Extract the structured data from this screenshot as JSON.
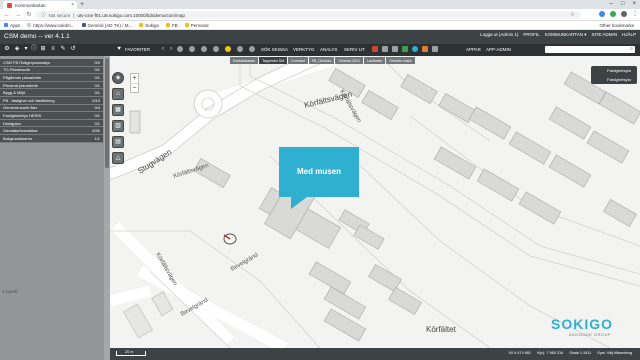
{
  "browser": {
    "tab_title": "Kommunkartan",
    "not_secure": "Not secure",
    "url": "utv-csm-f01.utv.sokigo.com:10000/bdsdemo/csm/map",
    "bookmarks": [
      "Apps",
      "https://www.sokdm...",
      "General (AD TK) / M...",
      "Sokigo",
      "FB",
      "Personal"
    ],
    "other_bookmarks": "Other bookmarks"
  },
  "app": {
    "title": "CSM demo -- ver 4.1.1",
    "user_nav": [
      "Logga ut (Admin 1)",
      "PROFIL",
      "KOMMUNKARTAN ▾",
      "SITE ADMIN",
      "HJÄLP"
    ],
    "toolbar_labels": {
      "favorites": "FAVORITER",
      "sok_skissa": "SÖK SKISSA",
      "verktyg": "VERKTYG",
      "analys": "ANALYS",
      "skriv_ut": "SKRIV UT",
      "appar": "APPAR",
      "app_admin": "APP-ADMIN"
    }
  },
  "sidebar": {
    "layers": [
      {
        "name": "CSM FB Rotigerpasanalys",
        "count": "0/0"
      },
      {
        "name": "TO-Planeracde",
        "count": "0/1"
      },
      {
        "name": "Pågående planarbete",
        "count": "0/1"
      },
      {
        "name": "Planerat planarbete",
        "count": "0/1"
      },
      {
        "name": "Bygg & Miljö",
        "count": "0/1"
      },
      {
        "name": "FB - fastighet och fastifulning",
        "count": "0/10"
      },
      {
        "name": "Gemenensamt åter",
        "count": "0/4"
      },
      {
        "name": "Fastighetsfrys HERIS",
        "count": "0/1"
      },
      {
        "name": "Detaljplan",
        "count": "0/1"
      },
      {
        "name": "Geodata/översiktsa",
        "count": "0/30"
      },
      {
        "name": "Bakgrundskartor",
        "count": "1/1"
      }
    ],
    "map_label": "s kapell"
  },
  "map": {
    "tabs": [
      "Kontaktkartan",
      "Tapperdsl DM",
      "Kontrast",
      "FB_Ortofoto",
      "Ortofoto 2021",
      "Lantkarte",
      "Ortofoto makk"
    ],
    "active_tab": 1,
    "background_items": [
      "Fastighetsyta",
      "Fastighetsyta"
    ],
    "callout": "Med musen",
    "streets": {
      "stugvagen": "Stugvägen",
      "korfaltsvagen_top": "Körfältsvägen",
      "korfaltsvagen_mid": "Körfältsvägen",
      "korfaltsvagen_left": "Körfältsvägen",
      "korfaltsvagen_side": "Körfältsvägen",
      "bevelgrand1": "Bevelgränd",
      "bevelgrand2": "Bevelgränd",
      "korfaltet": "Körfältet"
    },
    "zoom_in": "+",
    "zoom_out": "−"
  },
  "status": {
    "scale_label": "20 m",
    "x": "X0 6 474 881",
    "y": "N(v): 7 965 216",
    "scale": "Skala 1:1511",
    "system": "Syst: Välj tillkantning"
  },
  "logo": {
    "name": "SOKIGO",
    "sub": "ADDNODE GROUP"
  }
}
